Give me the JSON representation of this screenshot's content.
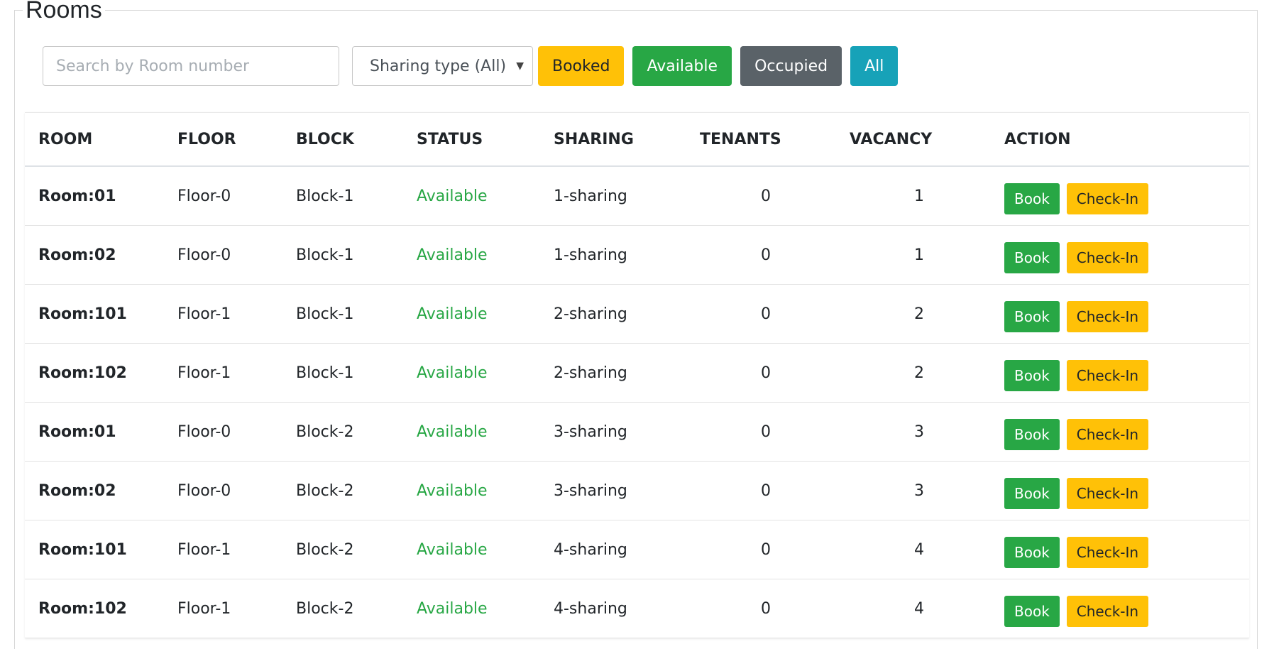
{
  "page": {
    "title": "Rooms"
  },
  "filters": {
    "search_placeholder": "Search by Room number",
    "sharing_select": "Sharing type (All)",
    "buttons": {
      "booked": "Booked",
      "available": "Available",
      "occupied": "Occupied",
      "all": "All"
    },
    "colors": {
      "booked": "#ffc107",
      "available": "#28a745",
      "occupied": "#5a6268",
      "all": "#17a2b8"
    }
  },
  "table": {
    "headers": [
      "ROOM",
      "FLOOR",
      "BLOCK",
      "STATUS",
      "SHARING",
      "TENANTS",
      "VACANCY",
      "ACTION"
    ],
    "action_labels": {
      "book": "Book",
      "checkin": "Check-In"
    },
    "rows": [
      {
        "room": "Room:01",
        "floor": "Floor-0",
        "block": "Block-1",
        "status": "Available",
        "sharing": "1-sharing",
        "tenants": "0",
        "vacancy": "1"
      },
      {
        "room": "Room:02",
        "floor": "Floor-0",
        "block": "Block-1",
        "status": "Available",
        "sharing": "1-sharing",
        "tenants": "0",
        "vacancy": "1"
      },
      {
        "room": "Room:101",
        "floor": "Floor-1",
        "block": "Block-1",
        "status": "Available",
        "sharing": "2-sharing",
        "tenants": "0",
        "vacancy": "2"
      },
      {
        "room": "Room:102",
        "floor": "Floor-1",
        "block": "Block-1",
        "status": "Available",
        "sharing": "2-sharing",
        "tenants": "0",
        "vacancy": "2"
      },
      {
        "room": "Room:01",
        "floor": "Floor-0",
        "block": "Block-2",
        "status": "Available",
        "sharing": "3-sharing",
        "tenants": "0",
        "vacancy": "3"
      },
      {
        "room": "Room:02",
        "floor": "Floor-0",
        "block": "Block-2",
        "status": "Available",
        "sharing": "3-sharing",
        "tenants": "0",
        "vacancy": "3"
      },
      {
        "room": "Room:101",
        "floor": "Floor-1",
        "block": "Block-2",
        "status": "Available",
        "sharing": "4-sharing",
        "tenants": "0",
        "vacancy": "4"
      },
      {
        "room": "Room:102",
        "floor": "Floor-1",
        "block": "Block-2",
        "status": "Available",
        "sharing": "4-sharing",
        "tenants": "0",
        "vacancy": "4"
      }
    ]
  }
}
